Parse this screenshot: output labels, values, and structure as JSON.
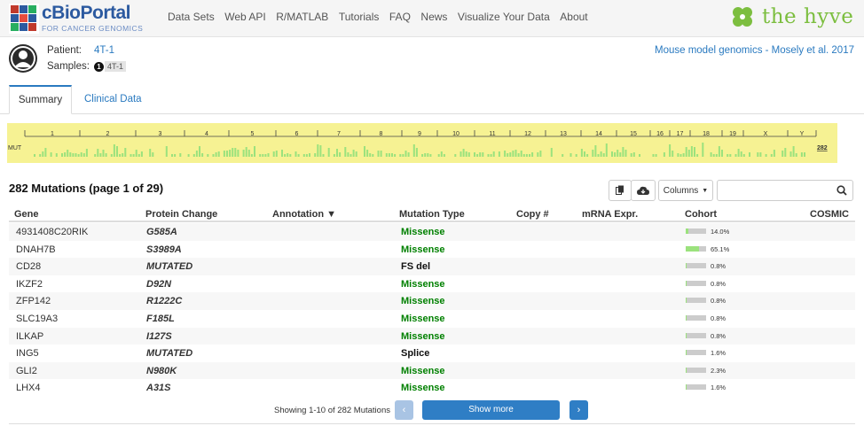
{
  "header": {
    "logo_main": "cBioPortal",
    "logo_sub": "FOR CANCER GENOMICS",
    "nav": [
      "Data Sets",
      "Web API",
      "R/MATLAB",
      "Tutorials",
      "FAQ",
      "News",
      "Visualize Your Data",
      "About"
    ],
    "partner_logo": "the hyve"
  },
  "patient": {
    "patient_label": "Patient:",
    "patient_id": "4T-1",
    "samples_label": "Samples:",
    "sample_index": "1",
    "sample_id": "4T-1",
    "study": "Mouse model genomics - Mosely et al. 2017"
  },
  "tabs": [
    "Summary",
    "Clinical Data"
  ],
  "genome": {
    "track_label": "MUT",
    "count": "282",
    "chromosomes": [
      "1",
      "2",
      "3",
      "4",
      "5",
      "6",
      "7",
      "8",
      "9",
      "10",
      "11",
      "12",
      "13",
      "14",
      "15",
      "16",
      "17",
      "18",
      "19",
      "X",
      "Y"
    ]
  },
  "mutations": {
    "title": "282 Mutations (page 1 of 29)",
    "columns_button": "Columns",
    "search_placeholder": "",
    "headers": [
      "Gene",
      "Protein Change",
      "Annotation ▼",
      "Mutation Type",
      "Copy #",
      "mRNA Expr.",
      "Cohort",
      "COSMIC"
    ],
    "rows": [
      {
        "gene": "4931408C20RIK",
        "protein": "G585A",
        "type": "Missense",
        "cohort_pct": "14.0%",
        "cohort_frac": 0.14
      },
      {
        "gene": "DNAH7B",
        "protein": "S3989A",
        "type": "Missense",
        "cohort_pct": "65.1%",
        "cohort_frac": 0.651
      },
      {
        "gene": "CD28",
        "protein": "MUTATED",
        "type": "FS del",
        "cohort_pct": "0.8%",
        "cohort_frac": 0.008
      },
      {
        "gene": "IKZF2",
        "protein": "D92N",
        "type": "Missense",
        "cohort_pct": "0.8%",
        "cohort_frac": 0.008
      },
      {
        "gene": "ZFP142",
        "protein": "R1222C",
        "type": "Missense",
        "cohort_pct": "0.8%",
        "cohort_frac": 0.008
      },
      {
        "gene": "SLC19A3",
        "protein": "F185L",
        "type": "Missense",
        "cohort_pct": "0.8%",
        "cohort_frac": 0.008
      },
      {
        "gene": "ILKAP",
        "protein": "I127S",
        "type": "Missense",
        "cohort_pct": "0.8%",
        "cohort_frac": 0.008
      },
      {
        "gene": "ING5",
        "protein": "MUTATED",
        "type": "Splice",
        "cohort_pct": "1.6%",
        "cohort_frac": 0.016
      },
      {
        "gene": "GLI2",
        "protein": "N980K",
        "type": "Missense",
        "cohort_pct": "2.3%",
        "cohort_frac": 0.023
      },
      {
        "gene": "LHX4",
        "protein": "A31S",
        "type": "Missense",
        "cohort_pct": "1.6%",
        "cohort_frac": 0.016
      }
    ],
    "pager_text": "Showing 1-10 of 282 Mutations",
    "prev": "‹",
    "next": "›",
    "show_more": "Show more"
  },
  "colors": {
    "brand": "#2c5aa0",
    "link": "#2a7ac0",
    "missense": "#008000",
    "genome_bg": "#f6f293",
    "mutation_tick": "#9be27d",
    "hyve_green": "#7cbe3f"
  }
}
